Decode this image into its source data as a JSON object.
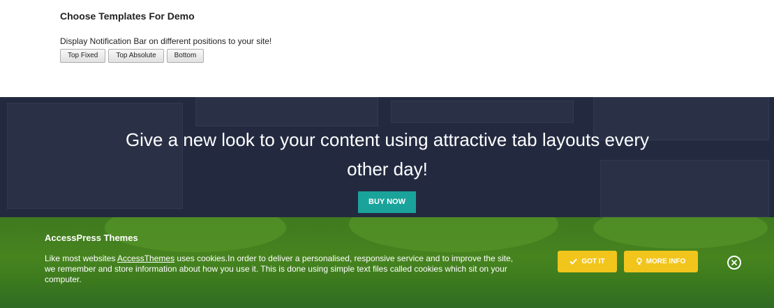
{
  "demo": {
    "title": "Choose Templates For Demo",
    "description": "Display Notification Bar on different positions to your site!",
    "buttons": [
      "Top Fixed",
      "Top Absolute",
      "Bottom"
    ]
  },
  "hero": {
    "heading": "Give a new look to your content using attractive tab layouts every other day!",
    "buy_label": "BUY NOW",
    "accent_color": "#1aa39a",
    "background_color": "#232a40"
  },
  "cookie": {
    "title": "AccessPress Themes",
    "text_before_link": "Like most websites ",
    "link_text": "AccessThemes",
    "text_after_link": " uses cookies.In order to deliver a personalised, responsive service and to improve the site, we remember and store information about how you use it. This is done using simple text files called cookies which sit on your computer.",
    "got_it_label": "GOT IT",
    "more_info_label": "MORE INFO",
    "button_color": "#f2c51c",
    "got_it_icon": "check-icon",
    "more_info_icon": "lightbulb-icon",
    "close_icon": "close-circle-icon"
  }
}
